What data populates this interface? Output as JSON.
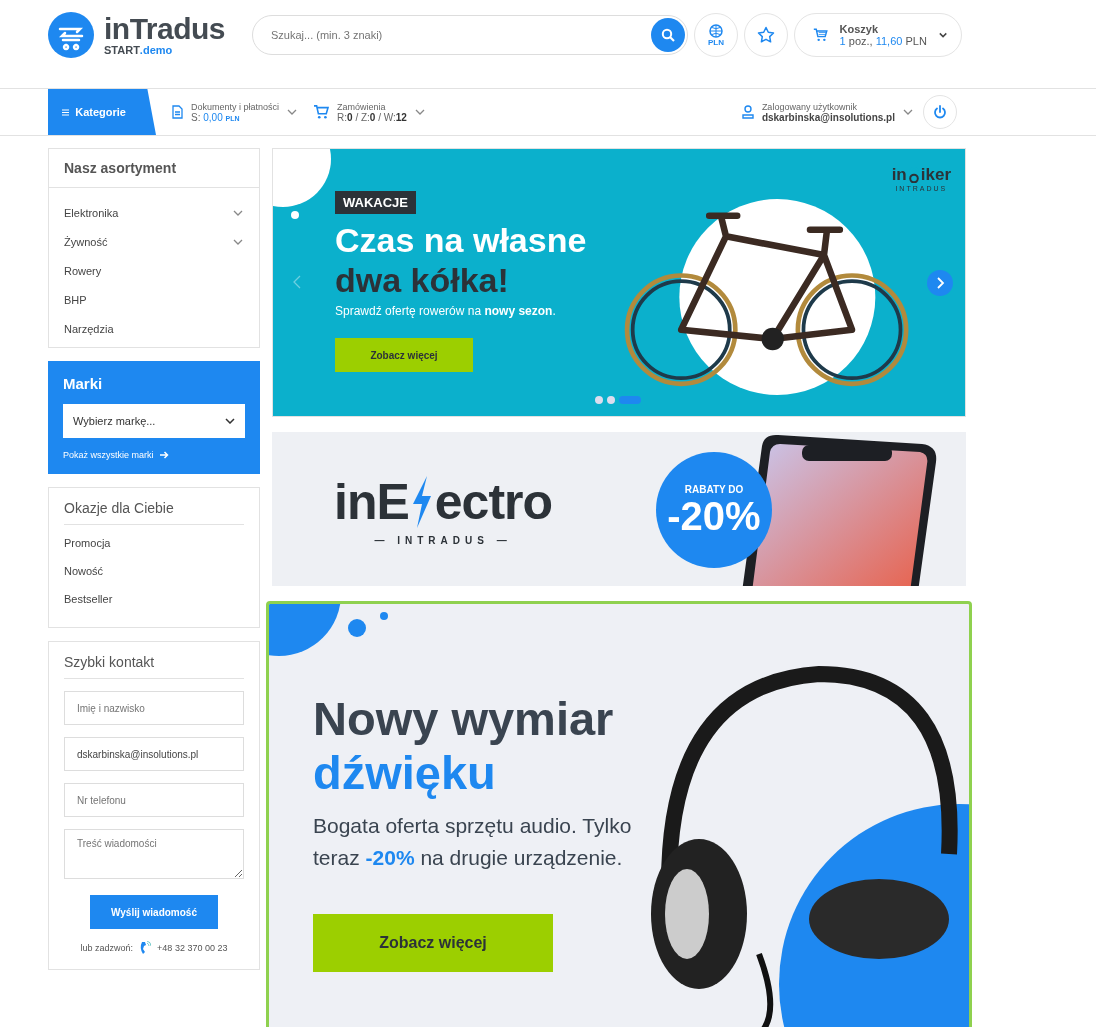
{
  "header": {
    "logo": {
      "name": "inTradus",
      "sub_left": "START",
      "sub_right": ".demo"
    },
    "search": {
      "placeholder": "Szukaj... (min. 3 znaki)"
    },
    "currency": "PLN",
    "cart": {
      "title": "Koszyk",
      "count": "1",
      "count_unit": "poz.,",
      "amount": "11,60",
      "currency": "PLN"
    }
  },
  "nav": {
    "categories": "Kategorie",
    "documents": {
      "label": "Dokumenty i płatności",
      "prefix": "S:",
      "amount": "0,00",
      "currency": "PLN"
    },
    "orders": {
      "label": "Zamówienia",
      "parts": [
        {
          "label": "R:",
          "value": "0"
        },
        {
          "label": "/ Z:",
          "value": "0"
        },
        {
          "label": "/ W:",
          "value": "12"
        }
      ]
    },
    "user": {
      "label": "Zalogowany użytkownik",
      "email": "dskarbinska@insolutions.pl"
    }
  },
  "sidebar": {
    "assortment": {
      "title": "Nasz asortyment",
      "items": [
        {
          "label": "Elektronika",
          "has_submenu": true
        },
        {
          "label": "Żywność",
          "has_submenu": true
        },
        {
          "label": "Rowery",
          "has_submenu": false
        },
        {
          "label": "BHP",
          "has_submenu": false
        },
        {
          "label": "Narzędzia",
          "has_submenu": false
        }
      ]
    },
    "brands": {
      "title": "Marki",
      "select": "Wybierz markę...",
      "link": "Pokaż wszystkie marki"
    },
    "deals": {
      "title": "Okazje dla Ciebie",
      "items": [
        "Promocja",
        "Nowość",
        "Bestseller"
      ]
    },
    "contact": {
      "title": "Szybki kontakt",
      "fields": [
        {
          "kind": "input",
          "placeholder": "Imię i nazwisko"
        },
        {
          "kind": "input",
          "value": "dskarbinska@insolutions.pl"
        },
        {
          "kind": "input",
          "placeholder": "Nr telefonu"
        },
        {
          "kind": "textarea",
          "placeholder": "Treść wiadomości"
        }
      ],
      "button": "Wyślij wiadomość",
      "call_label": "lub zadzwoń:",
      "phone": "+48 32 370 00 23"
    }
  },
  "banners": [
    {
      "kind": "bike",
      "tag": "WAKACJE",
      "title_line1": "Czas na własne",
      "title_line2": "dwa kółka!",
      "text": "Sprawdź ofertę rowerów na **nowy sezon**.",
      "button": "Zobacz więcej",
      "logo_left": "in",
      "logo_right": "iker",
      "logo_sub": "INTRADUS",
      "slides": [
        {
          "selected": false
        },
        {
          "selected": false
        },
        {
          "selected": true
        }
      ]
    },
    {
      "kind": "electro",
      "logo_left": "inE",
      "logo_right": "ectro",
      "logo_sub": "— INTRADUS —",
      "badge_top": "RABATY DO",
      "badge_value": "-20%"
    },
    {
      "kind": "audio",
      "title_line1": "Nowy wymiar",
      "title_line2": "dźwięku",
      "text": "Bogata oferta sprzętu audio. Tylko teraz **-20%** na drugie urządzenie.",
      "button": "Zobacz więcej"
    }
  ]
}
